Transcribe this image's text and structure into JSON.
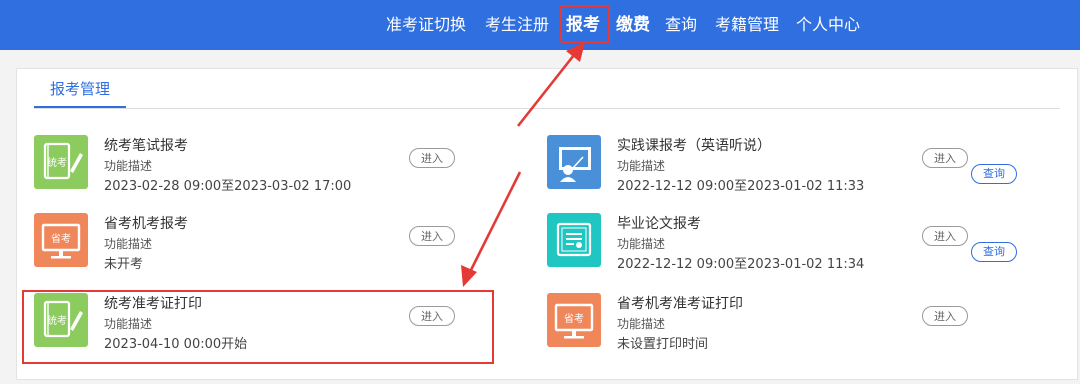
{
  "nav": {
    "items": [
      {
        "label": "准考证切换"
      },
      {
        "label": "考生注册"
      },
      {
        "label": "报考"
      },
      {
        "label": "缴费"
      },
      {
        "label": "查询"
      },
      {
        "label": "考籍管理"
      },
      {
        "label": "个人中心"
      }
    ]
  },
  "main": {
    "tab_label": "报考管理",
    "enter_label": "进入",
    "query_label": "查询",
    "cards": [
      {
        "title": "统考笔试报考",
        "desc": "功能描述",
        "time": "2023-02-28 09:00至2023-03-02 17:00",
        "icon": "certificate-pen-icon"
      },
      {
        "title": "实践课报考（英语听说）",
        "desc": "功能描述",
        "time": "2022-12-12 09:00至2023-01-02 11:33",
        "icon": "presenter-board-icon"
      },
      {
        "title": "省考机考报考",
        "desc": "功能描述",
        "time": "未开考",
        "icon": "computer-monitor-icon"
      },
      {
        "title": "毕业论文报考",
        "desc": "功能描述",
        "time": "2022-12-12 09:00至2023-01-02 11:34",
        "icon": "diploma-document-icon"
      },
      {
        "title": "统考准考证打印",
        "desc": "功能描述",
        "time": "2023-04-10 00:00开始",
        "icon": "certificate-pen-icon"
      },
      {
        "title": "省考机考准考证打印",
        "desc": "功能描述",
        "time": "未设置打印时间",
        "icon": "computer-monitor-icon"
      }
    ]
  },
  "icon_glyphs": {
    "calligraphy_a": "统考",
    "calligraphy_b": "省考"
  },
  "colors": {
    "nav_bg": "#2f6fe0",
    "accent": "#2f6fe0",
    "highlight": "#e53935",
    "icon_green": "#8ccc5f",
    "icon_blue": "#4a90d9",
    "icon_orange": "#f0875a",
    "icon_teal": "#1fc6c2"
  }
}
